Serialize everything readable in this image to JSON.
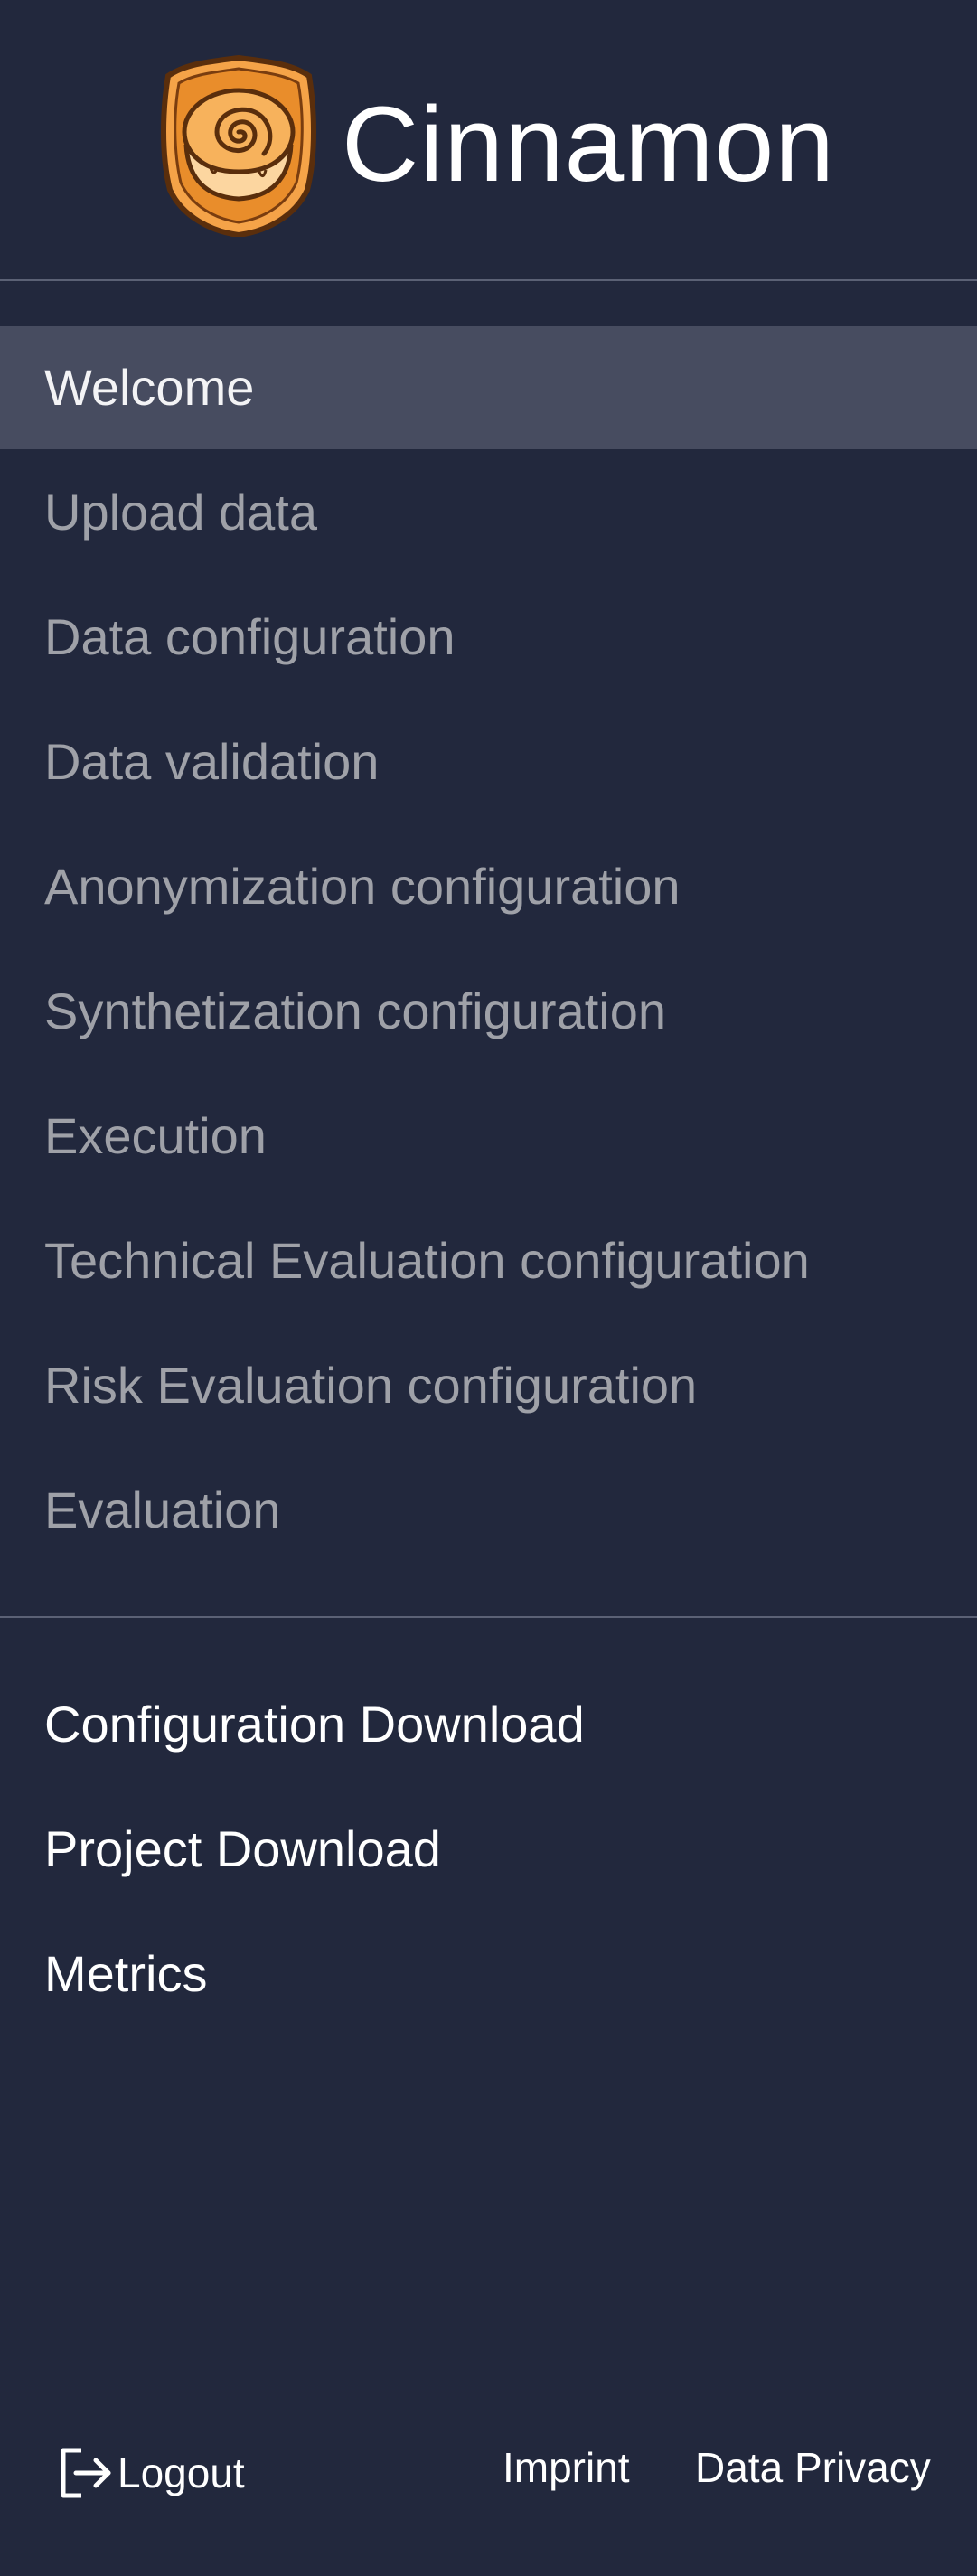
{
  "app": {
    "name": "Cinnamon"
  },
  "nav": {
    "items": [
      {
        "label": "Welcome",
        "active": true
      },
      {
        "label": "Upload data",
        "active": false
      },
      {
        "label": "Data configuration",
        "active": false
      },
      {
        "label": "Data validation",
        "active": false
      },
      {
        "label": "Anonymization configuration",
        "active": false
      },
      {
        "label": "Synthetization configuration",
        "active": false
      },
      {
        "label": "Execution",
        "active": false
      },
      {
        "label": "Technical Evaluation configuration",
        "active": false
      },
      {
        "label": "Risk Evaluation configuration",
        "active": false
      },
      {
        "label": "Evaluation",
        "active": false
      }
    ]
  },
  "tools": {
    "items": [
      {
        "label": "Configuration Download"
      },
      {
        "label": "Project Download"
      },
      {
        "label": "Metrics"
      }
    ]
  },
  "footer": {
    "logout_label": "Logout",
    "logout_icon": "logout-icon",
    "imprint_label": "Imprint",
    "privacy_label": "Data Privacy"
  },
  "colors": {
    "background": "#22283d",
    "active_item": "#474c60",
    "inactive_text": "#9fa1a8",
    "logo_orange": "#f5a348"
  }
}
